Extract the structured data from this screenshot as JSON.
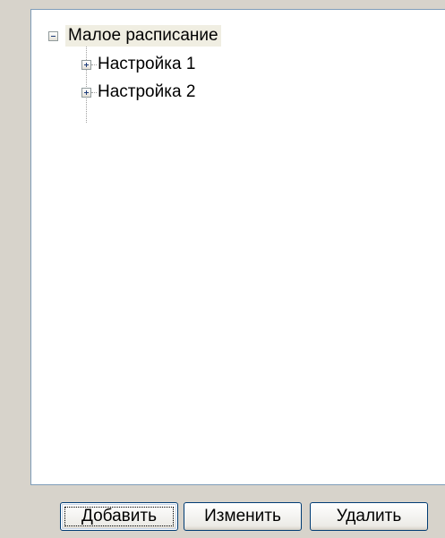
{
  "tree": {
    "root": {
      "label": "Малое расписание",
      "expanded": true,
      "icon": "minus-expander-icon"
    },
    "children": [
      {
        "label": "Настройка 1",
        "expanded": false,
        "icon": "plus-expander-icon"
      },
      {
        "label": "Настройка 2",
        "expanded": false,
        "icon": "plus-expander-icon"
      }
    ]
  },
  "buttons": {
    "add": "Добавить",
    "edit": "Изменить",
    "delete": "Удалить"
  },
  "colors": {
    "window_bg": "#d4d0c8",
    "tree_bg": "#ffffff",
    "tree_border": "#7f9db9",
    "selection_bg": "#f0eee2",
    "button_border": "#003c74"
  }
}
